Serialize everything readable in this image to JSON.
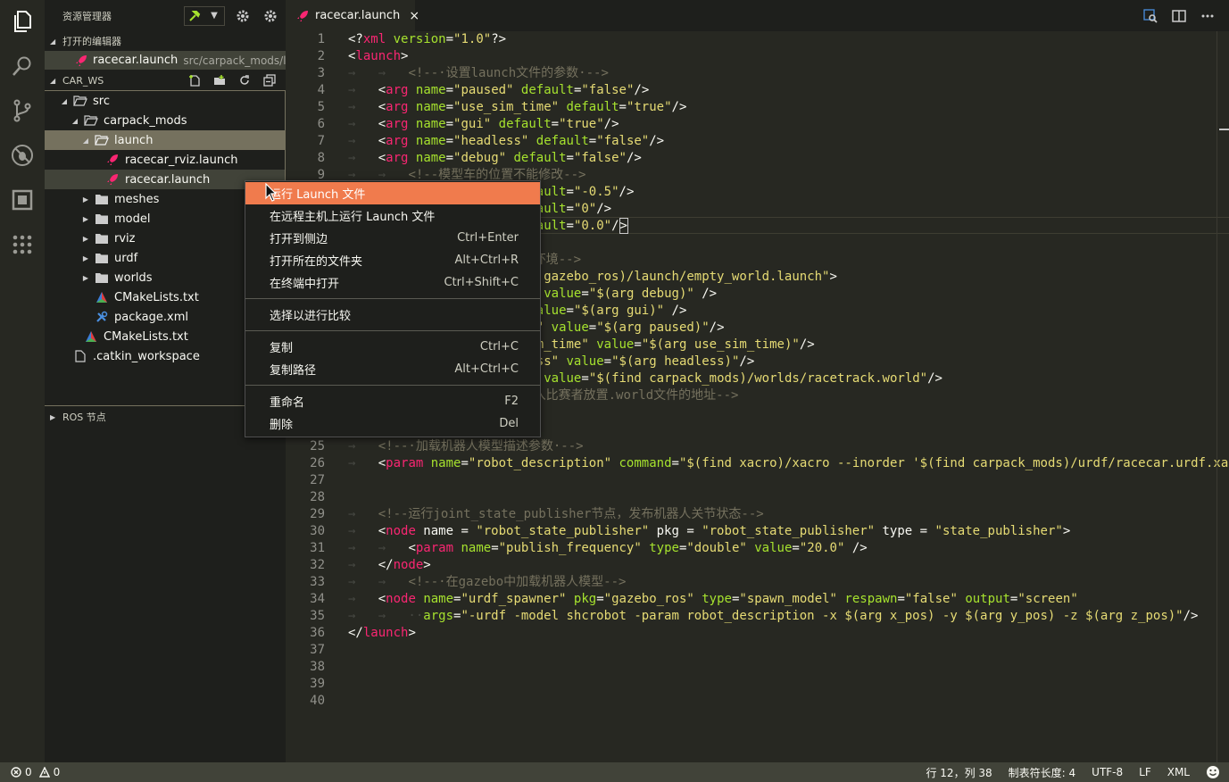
{
  "sidebar": {
    "title": "资源管理器",
    "open_editors_label": "打开的编辑器",
    "open_editor": {
      "name": "racecar.launch",
      "path": "src/carpack_mods/la..."
    },
    "workspace_label": "CAR_WS",
    "ros_nodes_label": "ROS 节点",
    "tree": [
      {
        "label": "src"
      },
      {
        "label": "carpack_mods"
      },
      {
        "label": "launch"
      },
      {
        "label": "racecar_rviz.launch"
      },
      {
        "label": "racecar.launch"
      },
      {
        "label": "meshes"
      },
      {
        "label": "model"
      },
      {
        "label": "rviz"
      },
      {
        "label": "urdf"
      },
      {
        "label": "worlds"
      },
      {
        "label": "CMakeLists.txt"
      },
      {
        "label": "package.xml"
      },
      {
        "label": "CMakeLists.txt"
      },
      {
        "label": ".catkin_workspace"
      }
    ]
  },
  "tab": {
    "name": "racecar.launch",
    "close": "×"
  },
  "editor": {
    "line_numbers": [
      "1",
      "2",
      "3",
      "4",
      "5",
      "6",
      "7",
      "8",
      "9",
      "10",
      "11",
      "12",
      "13",
      "14",
      "15",
      "16",
      "17",
      "18",
      "19",
      "20",
      "21",
      "22",
      "23",
      "24",
      "25",
      "26",
      "27",
      "28",
      "29",
      "30",
      "31",
      "32",
      "33",
      "34",
      "35",
      "36",
      "37",
      "38",
      "39",
      "40"
    ]
  },
  "context_menu": {
    "items": [
      {
        "label": "运行 Launch 文件",
        "key": ""
      },
      {
        "label": "在远程主机上运行 Launch 文件",
        "key": ""
      },
      {
        "label": "打开到侧边",
        "key": "Ctrl+Enter"
      },
      {
        "label": "打开所在的文件夹",
        "key": "Alt+Ctrl+R"
      },
      {
        "label": "在终端中打开",
        "key": "Ctrl+Shift+C"
      },
      {
        "label": "选择以进行比较",
        "key": ""
      },
      {
        "label": "复制",
        "key": "Ctrl+C"
      },
      {
        "label": "复制路径",
        "key": "Alt+Ctrl+C"
      },
      {
        "label": "重命名",
        "key": "F2"
      },
      {
        "label": "删除",
        "key": "Del"
      }
    ]
  },
  "status": {
    "errors": "0",
    "warnings": "0",
    "position": "行 12，列 38",
    "tab_size": "制表符长度: 4",
    "encoding": "UTF-8",
    "eol": "LF",
    "language": "XML"
  },
  "colors": {
    "accent": "#f07b4d",
    "tag": "#f92672",
    "attr": "#a6e22e",
    "string": "#e6db74",
    "comment": "#75715e"
  }
}
